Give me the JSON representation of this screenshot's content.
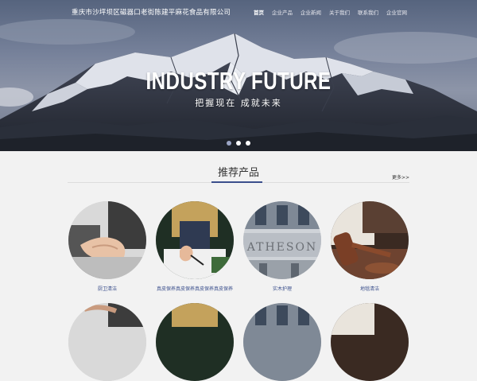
{
  "header": {
    "company_name": "重庆市沙坪坝区磁器口老街陈建平麻花食品有限公司",
    "nav": [
      {
        "label": "首页",
        "active": true
      },
      {
        "label": "企业产品",
        "active": false
      },
      {
        "label": "企业新闻",
        "active": false
      },
      {
        "label": "关于我们",
        "active": false
      },
      {
        "label": "联系我们",
        "active": false
      },
      {
        "label": "企业官网",
        "active": false
      }
    ]
  },
  "hero": {
    "title": "INDUSTRY FUTURE",
    "subtitle": "把握现在 成就未来",
    "slides": 3,
    "active_slide": 0
  },
  "section": {
    "title": "推荐产品",
    "more_label": "更多>>"
  },
  "products": [
    {
      "caption": "厨卫清洁",
      "icon": "handshake-icon"
    },
    {
      "caption": "真皮保养真皮保养真皮保养真皮保养",
      "icon": "signing-document-icon"
    },
    {
      "caption": "实木护理",
      "icon": "building-facade-icon"
    },
    {
      "caption": "地毯清洁",
      "icon": "gavel-icon"
    }
  ],
  "colors": {
    "accent": "#3b4f8c",
    "background": "#f2f2f2",
    "hero_text": "#ffffff"
  }
}
